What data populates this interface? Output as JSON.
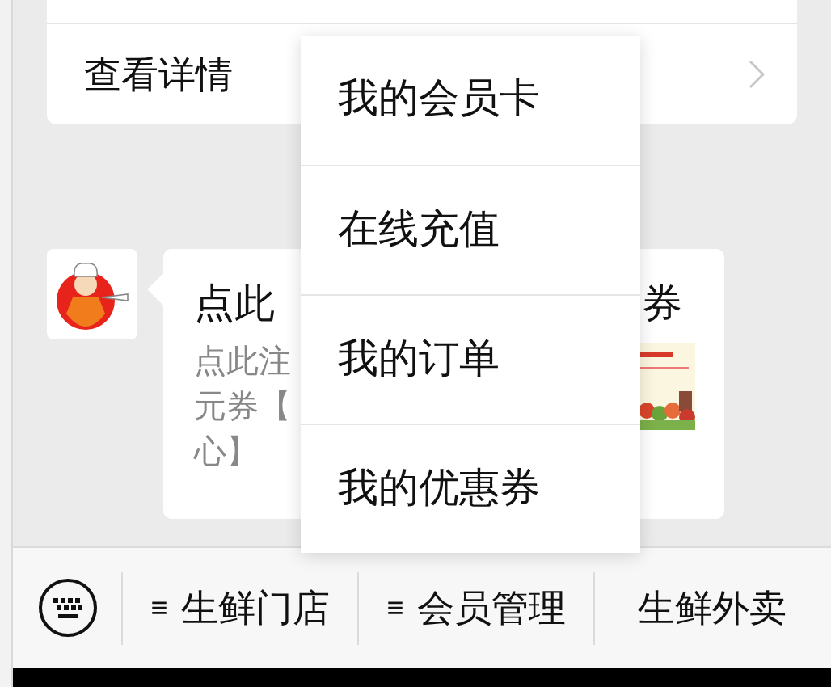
{
  "card": {
    "link_label": "查看详情"
  },
  "message": {
    "title_parts": [
      "点此",
      "券"
    ],
    "description_lines": [
      "点此注",
      "元券【",
      "心】"
    ],
    "thumbnail": {
      "kind": "picture"
    }
  },
  "popup_menu": {
    "items": [
      {
        "label": "我的会员卡"
      },
      {
        "label": "在线充值"
      },
      {
        "label": "我的订单"
      },
      {
        "label": "我的优惠券"
      }
    ]
  },
  "bottom_menu": {
    "items": [
      {
        "prefix": "≡",
        "label": "生鲜门店"
      },
      {
        "prefix": "≡",
        "label": "会员管理"
      },
      {
        "label": "生鲜外卖"
      }
    ]
  }
}
